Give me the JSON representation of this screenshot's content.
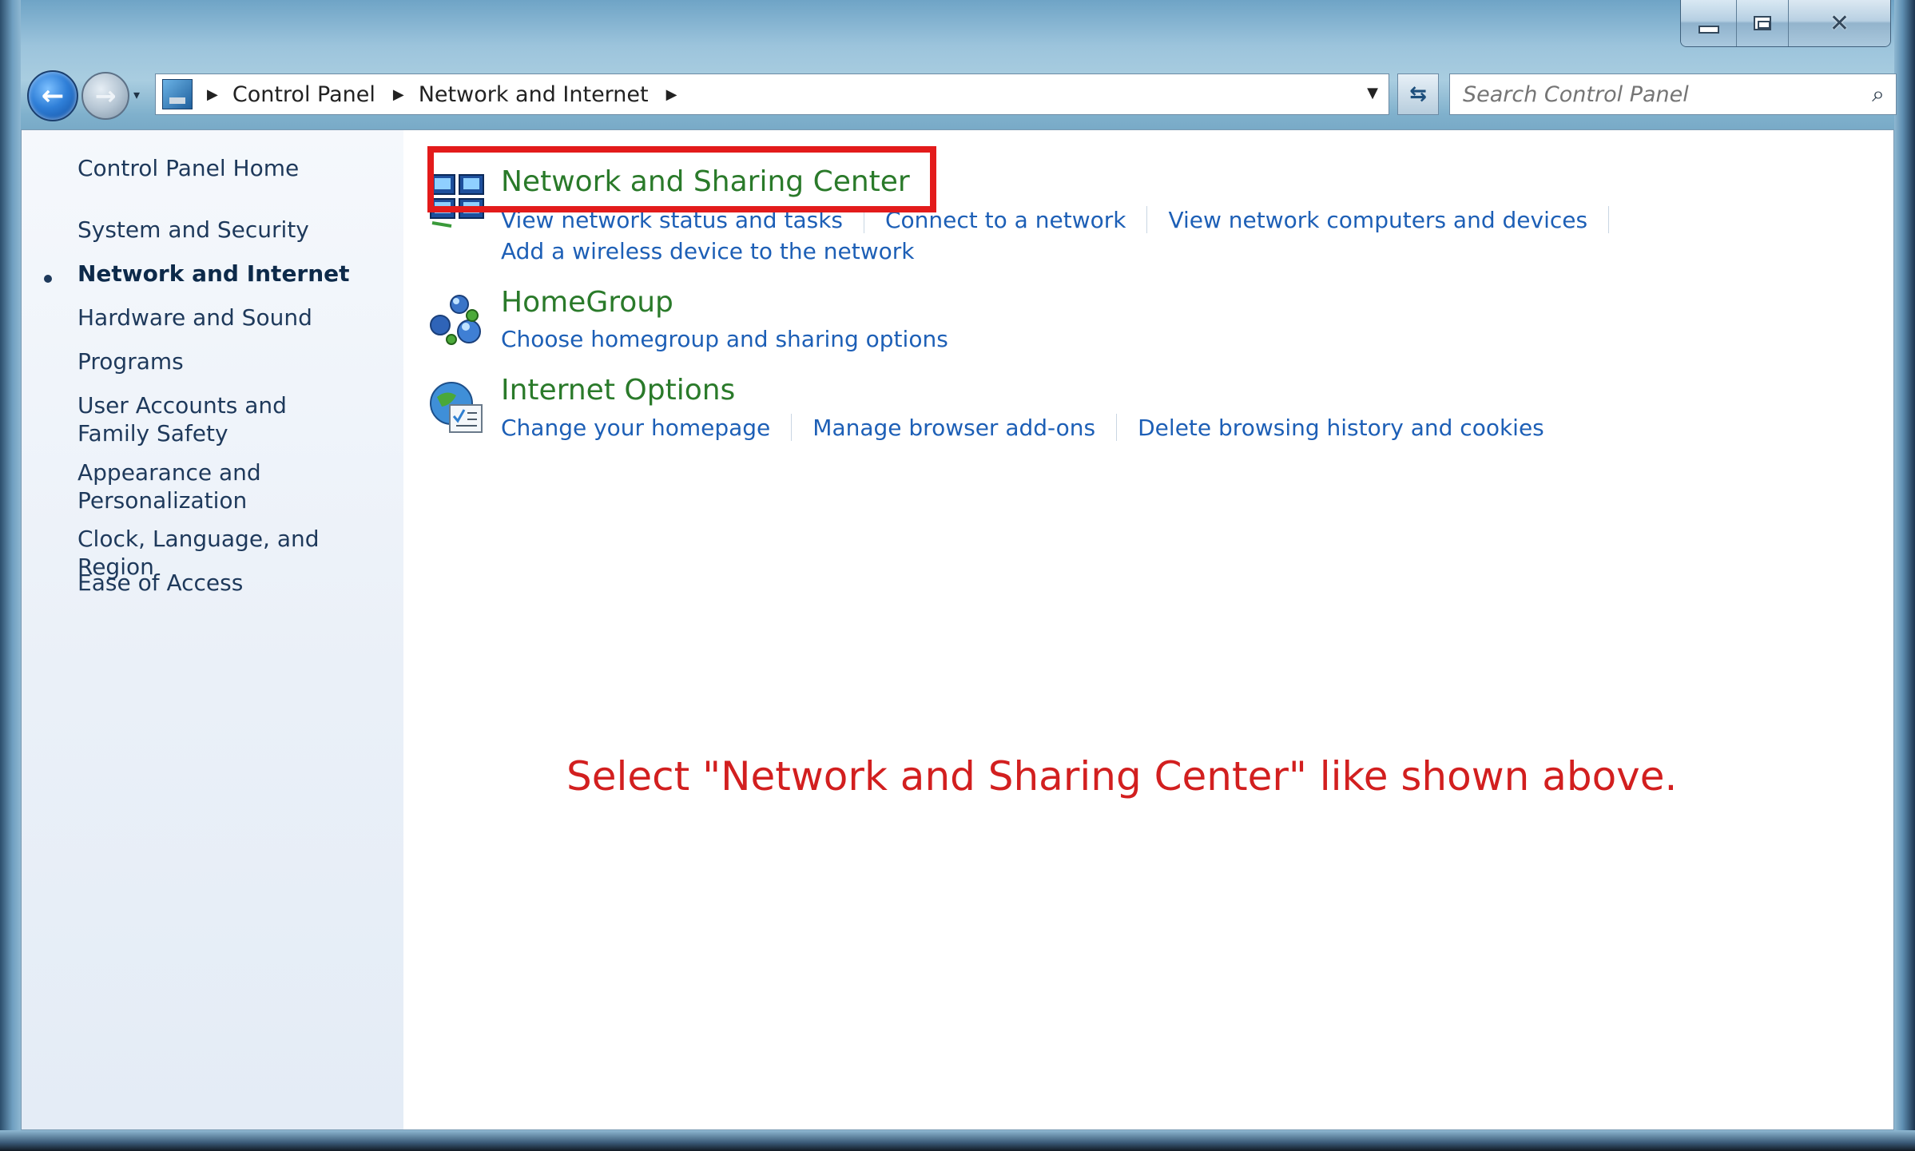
{
  "window": {
    "caption": {
      "minimize_icon": "minimize-icon",
      "maximize_icon": "maximize-icon",
      "close_icon": "close-icon"
    }
  },
  "navbar": {
    "back_icon": "back-arrow-icon",
    "forward_icon": "forward-arrow-icon",
    "breadcrumb": [
      "Control Panel",
      "Network and Internet"
    ],
    "refresh_icon": "refresh-icon",
    "search_placeholder": "Search Control Panel",
    "search_icon": "search-icon"
  },
  "sidebar": {
    "items": [
      {
        "label": "Control Panel Home"
      },
      {
        "label": "System and Security"
      },
      {
        "label": "Network and Internet",
        "active": true
      },
      {
        "label": "Hardware and Sound"
      },
      {
        "label": "Programs"
      },
      {
        "label": "User Accounts and Family Safety"
      },
      {
        "label": "Appearance and Personalization"
      },
      {
        "label": "Clock, Language, and Region"
      },
      {
        "label": "Ease of Access"
      }
    ]
  },
  "categories": [
    {
      "title": "Network and Sharing Center",
      "icon": "network-sharing-icon",
      "links": [
        "View network status and tasks",
        "Connect to a network",
        "View network computers and devices"
      ],
      "links_row2": [
        "Add a wireless device to the network"
      ]
    },
    {
      "title": "HomeGroup",
      "icon": "homegroup-icon",
      "links": [
        "Choose homegroup and sharing options"
      ]
    },
    {
      "title": "Internet Options",
      "icon": "internet-options-icon",
      "links": [
        "Change your homepage",
        "Manage browser add-ons",
        "Delete browsing history and cookies"
      ]
    }
  ],
  "annotation": {
    "instruction": "Select \"Network and Sharing Center\" like shown above.",
    "highlight_color": "#e31b1b"
  },
  "colors": {
    "category_title": "#2a7a2a",
    "link": "#1d5fb6",
    "sidebar_text": "#1e395b",
    "instruction": "#d21f1f"
  }
}
